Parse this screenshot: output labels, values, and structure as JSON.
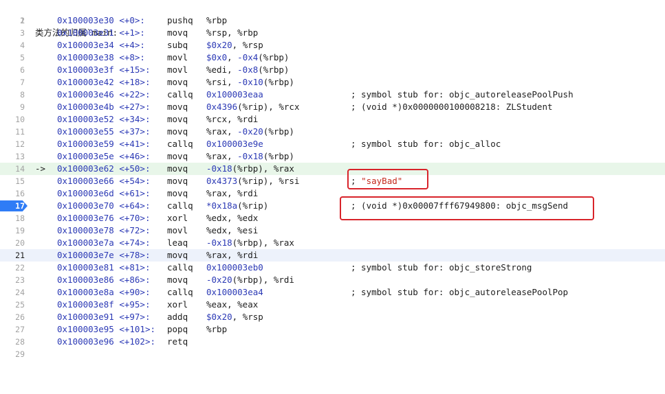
{
  "title": {
    "cjk": "类方法的归属",
    "symbol": "`main:"
  },
  "pc_arrow": "->",
  "lines": [
    {
      "n": "1"
    },
    {
      "n": "2",
      "addr": "0x100003e30",
      "off": "<+0>:",
      "mn": "pushq",
      "ops": "%rbp"
    },
    {
      "n": "3",
      "addr": "0x100003e31",
      "off": "<+1>:",
      "mn": "movq",
      "ops": "%rsp, %rbp"
    },
    {
      "n": "4",
      "addr": "0x100003e34",
      "off": "<+4>:",
      "mn": "subq",
      "ops": "$0x20, %rsp"
    },
    {
      "n": "5",
      "addr": "0x100003e38",
      "off": "<+8>:",
      "mn": "movl",
      "ops": "$0x0, -0x4(%rbp)"
    },
    {
      "n": "6",
      "addr": "0x100003e3f",
      "off": "<+15>:",
      "mn": "movl",
      "ops": "%edi, -0x8(%rbp)"
    },
    {
      "n": "7",
      "addr": "0x100003e42",
      "off": "<+18>:",
      "mn": "movq",
      "ops": "%rsi, -0x10(%rbp)"
    },
    {
      "n": "8",
      "addr": "0x100003e46",
      "off": "<+22>:",
      "mn": "callq",
      "ops": "0x100003eaa",
      "cmt": "; symbol stub for: objc_autoreleasePoolPush"
    },
    {
      "n": "9",
      "addr": "0x100003e4b",
      "off": "<+27>:",
      "mn": "movq",
      "ops": "0x4396(%rip), %rcx",
      "cmt": "; (void *)0x0000000100008218: ZLStudent"
    },
    {
      "n": "10",
      "addr": "0x100003e52",
      "off": "<+34>:",
      "mn": "movq",
      "ops": "%rcx, %rdi"
    },
    {
      "n": "11",
      "addr": "0x100003e55",
      "off": "<+37>:",
      "mn": "movq",
      "ops": "%rax, -0x20(%rbp)"
    },
    {
      "n": "12",
      "addr": "0x100003e59",
      "off": "<+41>:",
      "mn": "callq",
      "ops": "0x100003e9e",
      "cmt": "; symbol stub for: objc_alloc"
    },
    {
      "n": "13",
      "addr": "0x100003e5e",
      "off": "<+46>:",
      "mn": "movq",
      "ops": "%rax, -0x18(%rbp)"
    },
    {
      "n": "14",
      "addr": "0x100003e62",
      "off": "<+50>:",
      "mn": "movq",
      "ops": "-0x18(%rbp), %rax"
    },
    {
      "n": "15",
      "addr": "0x100003e66",
      "off": "<+54>:",
      "mn": "movq",
      "ops": "0x4373(%rip), %rsi",
      "cmt_prefix": "; ",
      "cmt_str": "\"sayBad\""
    },
    {
      "n": "16",
      "addr": "0x100003e6d",
      "off": "<+61>:",
      "mn": "movq",
      "ops": "%rax, %rdi"
    },
    {
      "n": "17",
      "addr": "0x100003e70",
      "off": "<+64>:",
      "mn": "callq",
      "ops": "*0x18a(%rip)",
      "cmt": "; (void *)0x00007fff67949800: objc_msgSend"
    },
    {
      "n": "18",
      "addr": "0x100003e76",
      "off": "<+70>:",
      "mn": "xorl",
      "ops": "%edx, %edx"
    },
    {
      "n": "19",
      "addr": "0x100003e78",
      "off": "<+72>:",
      "mn": "movl",
      "ops": "%edx, %esi"
    },
    {
      "n": "20",
      "addr": "0x100003e7a",
      "off": "<+74>:",
      "mn": "leaq",
      "ops": "-0x18(%rbp), %rax"
    },
    {
      "n": "21",
      "addr": "0x100003e7e",
      "off": "<+78>:",
      "mn": "movq",
      "ops": "%rax, %rdi"
    },
    {
      "n": "22",
      "addr": "0x100003e81",
      "off": "<+81>:",
      "mn": "callq",
      "ops": "0x100003eb0",
      "cmt": "; symbol stub for: objc_storeStrong"
    },
    {
      "n": "23",
      "addr": "0x100003e86",
      "off": "<+86>:",
      "mn": "movq",
      "ops": "-0x20(%rbp), %rdi"
    },
    {
      "n": "24",
      "addr": "0x100003e8a",
      "off": "<+90>:",
      "mn": "callq",
      "ops": "0x100003ea4",
      "cmt": "; symbol stub for: objc_autoreleasePoolPop"
    },
    {
      "n": "25",
      "addr": "0x100003e8f",
      "off": "<+95>:",
      "mn": "xorl",
      "ops": "%eax, %eax"
    },
    {
      "n": "26",
      "addr": "0x100003e91",
      "off": "<+97>:",
      "mn": "addq",
      "ops": "$0x20, %rsp"
    },
    {
      "n": "27",
      "addr": "0x100003e95",
      "off": "<+101>:",
      "mn": "popq",
      "ops": "%rbp"
    },
    {
      "n": "28",
      "addr": "0x100003e96",
      "off": "<+102>:",
      "mn": "retq"
    },
    {
      "n": "29"
    }
  ],
  "colors": {
    "address": "#2b39b5",
    "string": "#c4291b",
    "breakpoint": "#2f7cf6",
    "pc_line": "#e8f6e9",
    "current_line": "#edf2fb",
    "annotation_box": "#d8232a"
  }
}
